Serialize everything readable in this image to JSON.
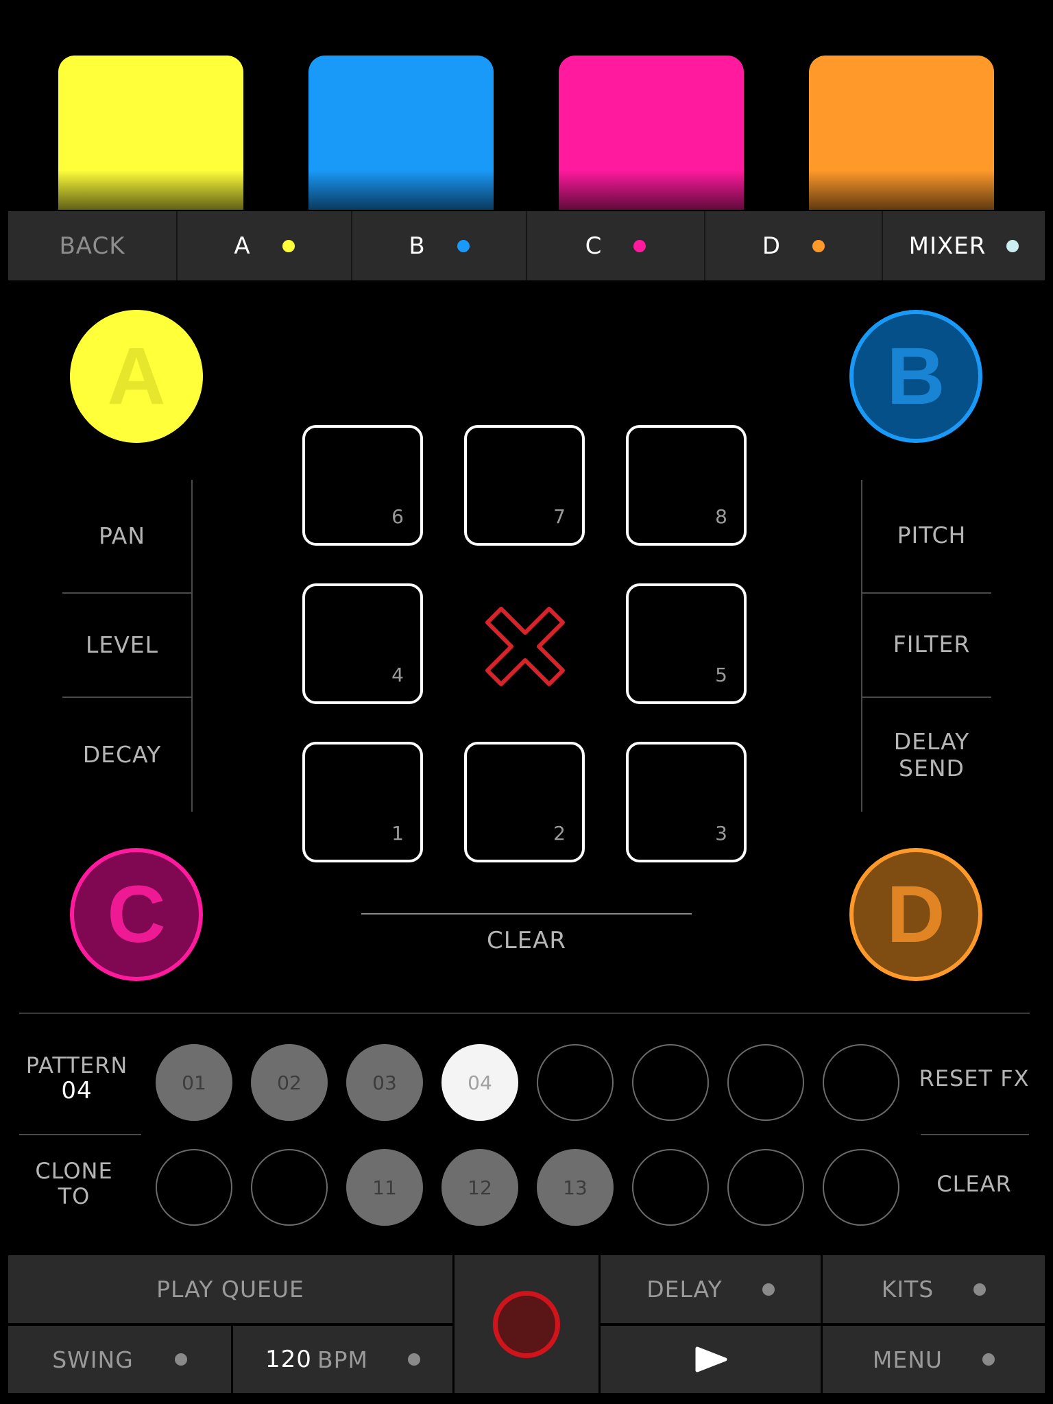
{
  "colors": {
    "pad_a": "#ffff3a",
    "pad_b": "#1a9af8",
    "pad_c": "#ff1a9e",
    "pad_d": "#ff9a2a",
    "mixer_dot": "#cdeef0",
    "record_ring": "#d0141b",
    "clear_x": "#d7232a"
  },
  "tabs": {
    "back": "BACK",
    "a": "A",
    "b": "B",
    "c": "C",
    "d": "D",
    "mixer": "MIXER"
  },
  "voices": {
    "a": "A",
    "b": "B",
    "c": "C",
    "d": "D"
  },
  "left_params": {
    "pan": "PAN",
    "level": "LEVEL",
    "decay": "DECAY"
  },
  "right_params": {
    "pitch": "PITCH",
    "filter": "FILTER",
    "delay_send_line1": "DELAY",
    "delay_send_line2": "SEND"
  },
  "grid_pads": {
    "p6": "6",
    "p7": "7",
    "p8": "8",
    "p4": "4",
    "p5": "5",
    "p1": "1",
    "p2": "2",
    "p3": "3"
  },
  "grid_clear": "CLEAR",
  "pattern": {
    "label": "PATTERN",
    "current": "04",
    "row1": [
      "01",
      "02",
      "03",
      "04",
      "",
      "",
      "",
      ""
    ],
    "row2": [
      "",
      "",
      "11",
      "12",
      "13",
      "",
      "",
      ""
    ],
    "reset_fx": "RESET FX",
    "clone_line1": "CLONE",
    "clone_line2": "TO",
    "clear": "CLEAR"
  },
  "transport": {
    "play_queue": "PLAY QUEUE",
    "delay": "DELAY",
    "kits": "KITS",
    "swing": "SWING",
    "bpm_value": "120",
    "bpm_unit": "BPM",
    "menu": "MENU"
  }
}
